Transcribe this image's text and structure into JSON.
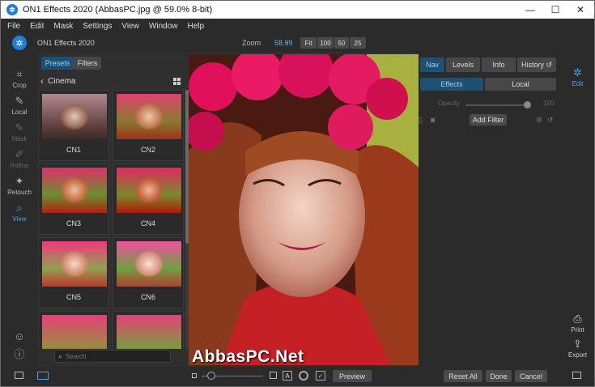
{
  "window": {
    "title": "ON1 Effects 2020 (AbbasPC.jpg @ 59.0% 8-bit)",
    "minimize": "—",
    "maximize": "☐",
    "close": "✕"
  },
  "menu": [
    "File",
    "Edit",
    "Mask",
    "Settings",
    "View",
    "Window",
    "Help"
  ],
  "topbar": {
    "app_title": "ON1 Effects 2020",
    "zoom_label": "Zoom",
    "zoom_value": "58.99",
    "zoom_buttons": [
      "Fit",
      "100",
      "50",
      "25"
    ]
  },
  "left_tools": [
    {
      "label": "Crop",
      "icon": "crop-icon",
      "glyph": "⌗"
    },
    {
      "label": "Local",
      "icon": "brush-icon",
      "glyph": "✎"
    },
    {
      "label": "Mask",
      "icon": "mask-brush-icon",
      "glyph": "✎"
    },
    {
      "label": "Refine",
      "icon": "refine-icon",
      "glyph": "✐"
    },
    {
      "label": "Retouch",
      "icon": "retouch-icon",
      "glyph": "✦"
    },
    {
      "label": "View",
      "icon": "view-zoom-icon",
      "glyph": "⌕"
    }
  ],
  "browser": {
    "tabs": [
      "Presets",
      "Filters"
    ],
    "category": "Cinema",
    "presets": [
      "CN1",
      "CN2",
      "CN3",
      "CN4",
      "CN5",
      "CN6"
    ],
    "search_placeholder": "Search"
  },
  "right_panel": {
    "tabs": [
      "Nav",
      "Levels",
      "Info",
      "History"
    ],
    "history_glyph": "↺",
    "subtabs": [
      "Effects",
      "Local"
    ],
    "opacity_label": "Opacity",
    "opacity_value": "100",
    "add_filter": "Add Filter"
  },
  "far_right": {
    "edit": "Edit",
    "print": "Print",
    "export": "Export"
  },
  "bottom": {
    "preview": "Preview",
    "reset_all": "Reset All",
    "done": "Done",
    "cancel": "Cancel",
    "text_icon": "A"
  },
  "watermark": "AbbasPC.Net",
  "colors": {
    "accent": "#4aa3e8",
    "active_tab": "#1f4f73"
  }
}
